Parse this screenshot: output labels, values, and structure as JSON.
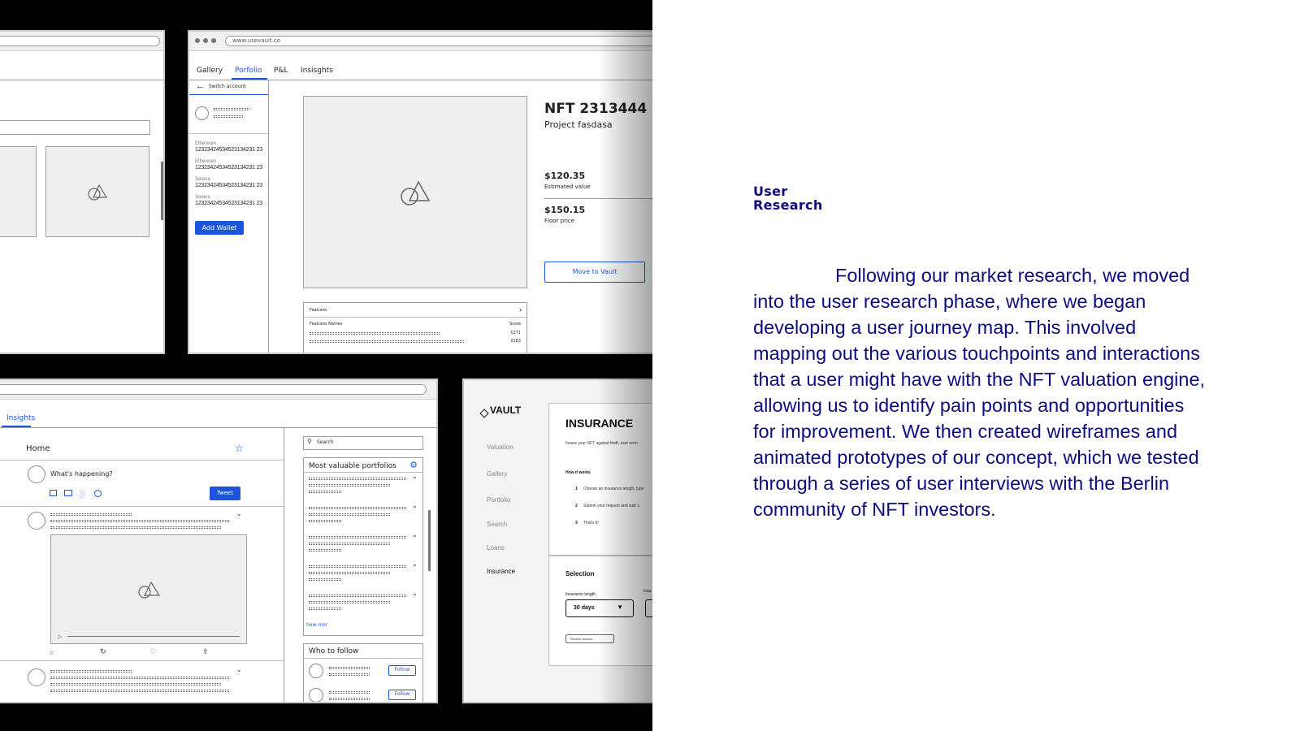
{
  "colors": {
    "accent": "#1a56db",
    "heading": "#0d0d80",
    "backdrop": "#000000"
  },
  "article": {
    "heading_line1": "User",
    "heading_line2": "Research",
    "body": "Following our market research, we moved into the user research phase, where we began developing a user journey map. This involved mapping out the various touchpoints and interactions that a user might have with the NFT valuation engine, allowing us to identify pain points and opportunities for improvement. We then created wireframes and animated prototypes of our concept, which we tested through a series of user interviews with the Berlin community of NFT investors."
  },
  "portfolio_wireframe": {
    "url": "www.usevault.co",
    "tabs": [
      "Gallery",
      "Porfolio",
      "P&L",
      "Insisghts"
    ],
    "switch_account": "Switch account",
    "wallets": [
      {
        "label": "Ethereum",
        "address": "12323424534523134231 23"
      },
      {
        "label": "Ethereum",
        "address": "12323424534523134231 23"
      },
      {
        "label": "Solana",
        "address": "12323424534523134231 23"
      },
      {
        "label": "Solana",
        "address": "12323424534523134231 23"
      }
    ],
    "add_wallet": "Add Wallet",
    "nft_title": "NFT 2313444",
    "project": "Project fasdasa",
    "estimated_value": "$120.35",
    "estimated_label": "Estimated value",
    "floor_price": "$150.15",
    "floor_label": "Floor price",
    "move_button": "Move to Vault",
    "features_title": "Features",
    "features_col1": "Features Names",
    "features_col2": "Score",
    "scores": [
      "5271",
      "3183"
    ]
  },
  "social_wireframe": {
    "tab": "Insights",
    "home": "Home",
    "compose_placeholder": "What's happening?",
    "tweet_button": "Tweet",
    "search_placeholder": "Search",
    "portfolios_title": "Most valuable portfolios",
    "show_more": "how mor",
    "who_to_follow": "Who to follow",
    "follow_label": "Follow"
  },
  "vault_wireframe": {
    "logo": "VAULT",
    "nav": [
      "Valuation",
      "Gallery",
      "Portfolio",
      "Search",
      "Loans",
      "Insurance"
    ],
    "title": "INSURANCE",
    "intro": "Insure your NFT against theft, user error",
    "how_it_works": "How it works",
    "steps": [
      {
        "n": "1",
        "text": "Choose an insurance length, type"
      },
      {
        "n": "2",
        "text": "Submit your request and wait 1-"
      },
      {
        "n": "3",
        "text": "That's it!"
      }
    ],
    "selection": "Selection",
    "insurance_length": "Insurance length",
    "insurance_cut": "Insu",
    "length_value": "30 days",
    "review_options": "Review options"
  }
}
